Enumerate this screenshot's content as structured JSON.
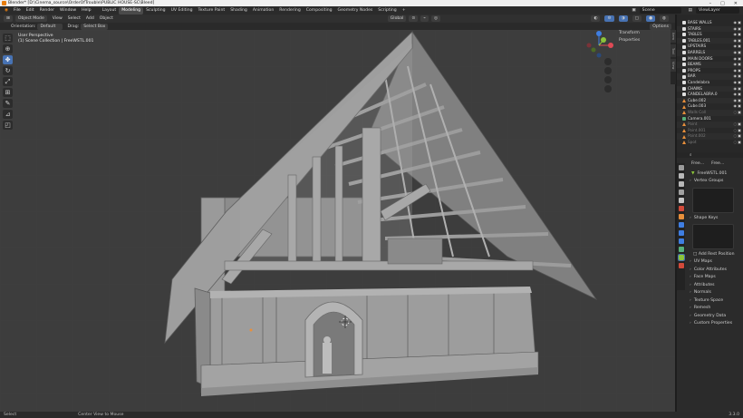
{
  "title_bar": {
    "text": "Blender* [D:\\Cinema_source\\OrderOfTrouble\\PUBLIC HOUSE-SC\\Bleed]",
    "controls": [
      "–",
      "□",
      "✕"
    ]
  },
  "menu": [
    "File",
    "Edit",
    "Render",
    "Window",
    "Help"
  ],
  "workspaces": [
    "Layout",
    "Modeling",
    "Sculpting",
    "UV Editing",
    "Texture Paint",
    "Shading",
    "Animation",
    "Rendering",
    "Compositing",
    "Geometry Nodes",
    "Scripting",
    "+"
  ],
  "active_workspace": "Modeling",
  "scene_name": "Scene",
  "view_layer": "ViewLayer",
  "viewport_header": {
    "mode": "Object Mode",
    "menus": [
      "View",
      "Select",
      "Add",
      "Object"
    ],
    "transform_orientation": "Global",
    "options": "Options"
  },
  "tool_settings": {
    "orientation_label": "Orientation:",
    "orientation": "Default",
    "drag_label": "Drag:",
    "drag": "Select Box"
  },
  "viewport_info": {
    "line1": "User Perspective",
    "line2": "(1) Scene Collection | FreeWSTL.001"
  },
  "npanel": {
    "rows": [
      "Transform",
      "Properties"
    ],
    "tabs": [
      "Item",
      "Tool",
      "View",
      "Edit"
    ]
  },
  "outliner": {
    "items": [
      {
        "label": "BASE WALLS",
        "dim": false
      },
      {
        "label": "STAIRS",
        "dim": false
      },
      {
        "label": "TABLES",
        "dim": false
      },
      {
        "label": "TABLES.001",
        "dim": false
      },
      {
        "label": "UPSTAIRS",
        "dim": false
      },
      {
        "label": "BARRELS",
        "dim": false
      },
      {
        "label": "MAIN DOORS",
        "dim": false
      },
      {
        "label": "BEAMS",
        "dim": false
      },
      {
        "label": "PROPS",
        "dim": false
      },
      {
        "label": "BAR",
        "dim": false
      },
      {
        "label": "Candelabra",
        "dim": false
      },
      {
        "label": "CHAINS",
        "dim": false
      },
      {
        "label": "CANDELABRA.0",
        "dim": false
      },
      {
        "label": "Cube.002",
        "dim": false
      },
      {
        "label": "Cube.003",
        "dim": false
      },
      {
        "label": "Walls Coll",
        "dim": true
      },
      {
        "label": "Camera.001",
        "dim": false
      },
      {
        "label": "Point",
        "dim": true
      },
      {
        "label": "Point.001",
        "dim": true
      },
      {
        "label": "Point.002",
        "dim": true
      },
      {
        "label": "Spot",
        "dim": true
      }
    ]
  },
  "properties": {
    "breadcrumb": [
      "Free...",
      "Free..."
    ],
    "mesh_name": "FreeWSTL.001",
    "sections_top": [
      "Vertex Groups"
    ],
    "sections_mid": [
      "Shape Keys"
    ],
    "add_rest": "Add Rest Position",
    "sections": [
      "UV Maps",
      "Color Attributes",
      "Face Maps",
      "Attributes",
      "Normals",
      "Texture Space",
      "Remesh",
      "Geometry Data",
      "Custom Properties"
    ]
  },
  "status": {
    "left": "Select",
    "mid": "Center View to Mouse",
    "version": "3.3.0"
  },
  "colors": {
    "accent": "#4772b3",
    "orange": "#e87d0d",
    "x_axis": "#e04a55",
    "y_axis": "#8cc43a",
    "z_axis": "#3f7ee2"
  }
}
